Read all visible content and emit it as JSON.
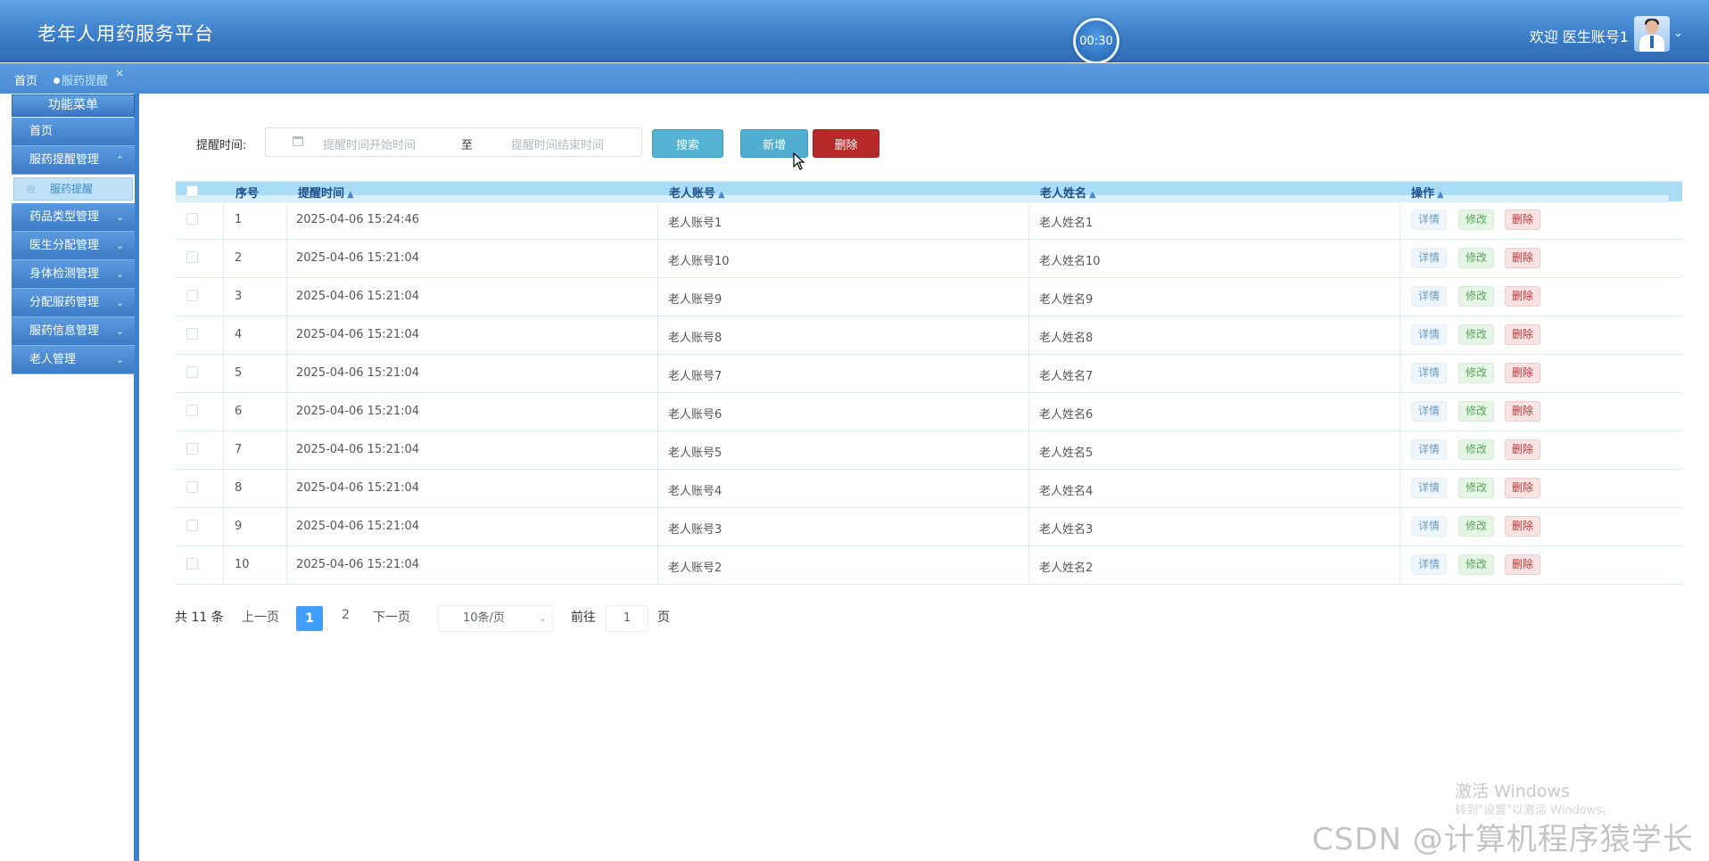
{
  "header": {
    "app_title": "老年人用药服务平台",
    "timer": "00:30",
    "welcome": "欢迎 医生账号1"
  },
  "breadcrumb": {
    "home": "首页",
    "active": "服药提醒",
    "close": "×"
  },
  "sidebar": {
    "title": "功能菜单",
    "items": [
      {
        "label": "首页",
        "expanded": false,
        "has_children": false
      },
      {
        "label": "服药提醒管理",
        "expanded": true,
        "has_children": true,
        "children": [
          "服药提醒"
        ]
      },
      {
        "label": "药品类型管理",
        "expanded": false,
        "has_children": true
      },
      {
        "label": "医生分配管理",
        "expanded": false,
        "has_children": true
      },
      {
        "label": "身体检测管理",
        "expanded": false,
        "has_children": true
      },
      {
        "label": "分配服药管理",
        "expanded": false,
        "has_children": true
      },
      {
        "label": "服药信息管理",
        "expanded": false,
        "has_children": true
      },
      {
        "label": "老人管理",
        "expanded": false,
        "has_children": true
      }
    ]
  },
  "search": {
    "label": "提醒时间:",
    "start_placeholder": "提醒时间开始时间",
    "separator": "至",
    "end_placeholder": "提醒时间结束时间",
    "search_button": "搜索",
    "add_button": "新增",
    "delete_button": "删除"
  },
  "table": {
    "columns": [
      "序号",
      "提醒时间",
      "老人账号",
      "老人姓名",
      "操作"
    ],
    "rows": [
      {
        "index": "1",
        "time": "2025-04-06 15:24:46",
        "account": "老人账号1",
        "name": "老人姓名1"
      },
      {
        "index": "2",
        "time": "2025-04-06 15:21:04",
        "account": "老人账号10",
        "name": "老人姓名10"
      },
      {
        "index": "3",
        "time": "2025-04-06 15:21:04",
        "account": "老人账号9",
        "name": "老人姓名9"
      },
      {
        "index": "4",
        "time": "2025-04-06 15:21:04",
        "account": "老人账号8",
        "name": "老人姓名8"
      },
      {
        "index": "5",
        "time": "2025-04-06 15:21:04",
        "account": "老人账号7",
        "name": "老人姓名7"
      },
      {
        "index": "6",
        "time": "2025-04-06 15:21:04",
        "account": "老人账号6",
        "name": "老人姓名6"
      },
      {
        "index": "7",
        "time": "2025-04-06 15:21:04",
        "account": "老人账号5",
        "name": "老人姓名5"
      },
      {
        "index": "8",
        "time": "2025-04-06 15:21:04",
        "account": "老人账号4",
        "name": "老人姓名4"
      },
      {
        "index": "9",
        "time": "2025-04-06 15:21:04",
        "account": "老人账号3",
        "name": "老人姓名3"
      },
      {
        "index": "10",
        "time": "2025-04-06 15:21:04",
        "account": "老人账号2",
        "name": "老人姓名2"
      }
    ],
    "actions": {
      "detail": "详情",
      "edit": "修改",
      "delete": "删除"
    }
  },
  "pagination": {
    "total": "共 11 条",
    "prev": "上一页",
    "pages": [
      "1",
      "2"
    ],
    "current": "1",
    "next": "下一页",
    "page_size": "10条/页",
    "goto_label": "前往",
    "goto_value": "1",
    "page_suffix": "页"
  },
  "watermarks": {
    "windows_title": "激活 Windows",
    "windows_sub": "转到\"设置\"以激活 Windows。",
    "csdn": "CSDN @计算机程序猿学长"
  },
  "colors": {
    "header": "#3c7dc8",
    "accent": "#409eff",
    "search_button": "#55b2d3",
    "delete_button": "#b62a2a"
  }
}
